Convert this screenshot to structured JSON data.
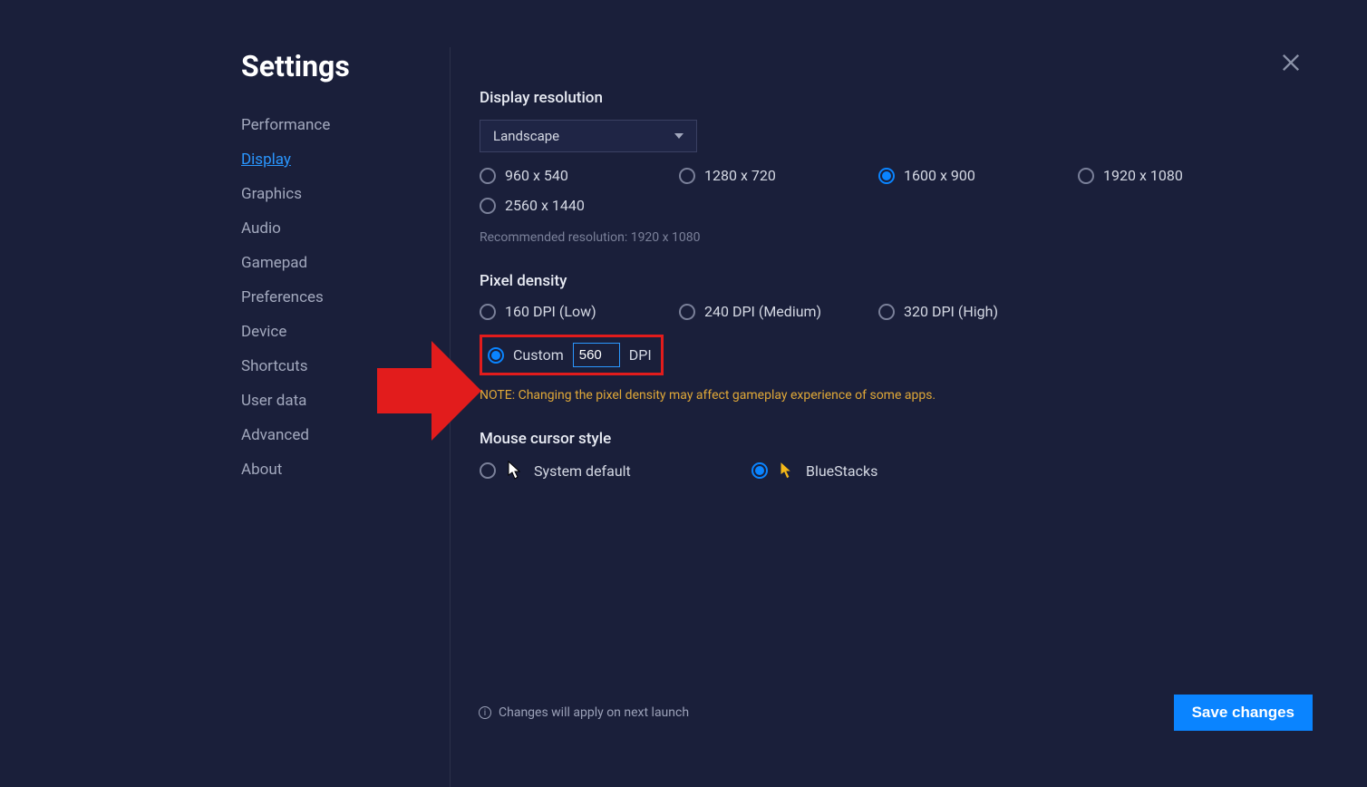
{
  "title": "Settings",
  "sidebar": {
    "items": [
      {
        "label": "Performance",
        "active": false
      },
      {
        "label": "Display",
        "active": true
      },
      {
        "label": "Graphics",
        "active": false
      },
      {
        "label": "Audio",
        "active": false
      },
      {
        "label": "Gamepad",
        "active": false
      },
      {
        "label": "Preferences",
        "active": false
      },
      {
        "label": "Device",
        "active": false
      },
      {
        "label": "Shortcuts",
        "active": false
      },
      {
        "label": "User data",
        "active": false
      },
      {
        "label": "Advanced",
        "active": false
      },
      {
        "label": "About",
        "active": false
      }
    ]
  },
  "display": {
    "resolution": {
      "title": "Display resolution",
      "orientation_selected": "Landscape",
      "options": [
        {
          "label": "960 x 540",
          "selected": false
        },
        {
          "label": "1280 x 720",
          "selected": false
        },
        {
          "label": "1600 x 900",
          "selected": true
        },
        {
          "label": "1920 x 1080",
          "selected": false
        },
        {
          "label": "2560 x 1440",
          "selected": false
        }
      ],
      "recommended": "Recommended resolution: 1920 x 1080"
    },
    "pixel_density": {
      "title": "Pixel density",
      "options": [
        {
          "label": "160 DPI (Low)",
          "selected": false
        },
        {
          "label": "240 DPI (Medium)",
          "selected": false
        },
        {
          "label": "320 DPI (High)",
          "selected": false
        }
      ],
      "custom": {
        "label": "Custom",
        "value": "560",
        "unit": "DPI",
        "selected": true
      },
      "note": "NOTE: Changing the pixel density may affect gameplay experience of some apps."
    },
    "cursor": {
      "title": "Mouse cursor style",
      "options": [
        {
          "label": "System default",
          "selected": false
        },
        {
          "label": "BlueStacks",
          "selected": true
        }
      ]
    }
  },
  "footer": {
    "note": "Changes will apply on next launch",
    "save_label": "Save changes"
  }
}
